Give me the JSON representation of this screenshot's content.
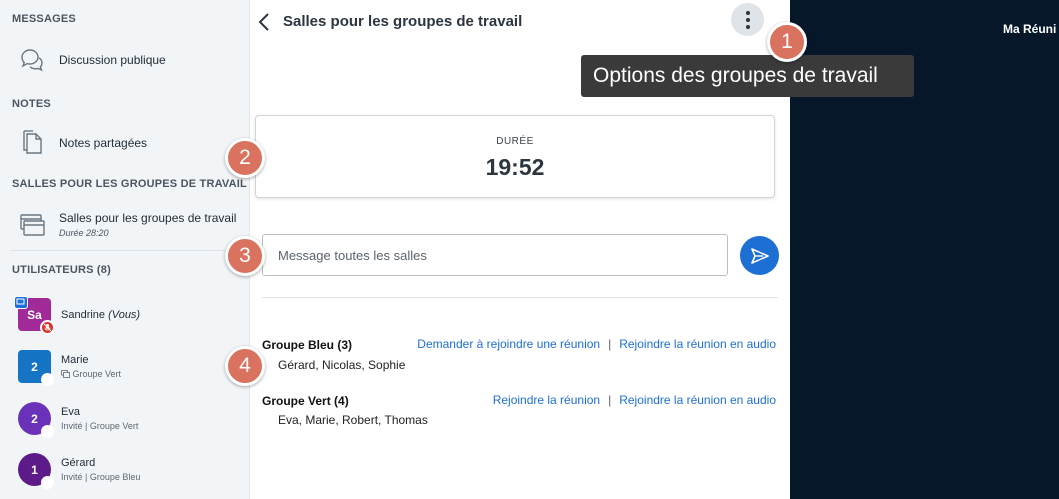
{
  "sidebar": {
    "messages_title": "MESSAGES",
    "public_chat": "Discussion publique",
    "notes_title": "NOTES",
    "shared_notes": "Notes partagées",
    "breakout_title": "SALLES POUR LES GROUPES DE TRAVAIL",
    "breakout_item": "Salles pour les groupes de travail",
    "breakout_duration": "Durée 28:20",
    "users_title": "UTILISATEURS (8)",
    "users": [
      {
        "initials": "Sa",
        "name": "Sandrine",
        "you": "(Vous)",
        "sub": "",
        "color": "#a02a98"
      },
      {
        "initials": "2",
        "name": "Marie",
        "you": "",
        "sub": "Groupe Vert",
        "color": "#1674c4"
      },
      {
        "initials": "2",
        "name": "Eva",
        "you": "",
        "sub": "Invité | Groupe Vert",
        "color": "#6a32b8"
      },
      {
        "initials": "1",
        "name": "Gérard",
        "you": "",
        "sub": "Invité | Groupe Bleu",
        "color": "#5c1b88"
      }
    ]
  },
  "panel": {
    "title": "Salles pour les groupes de travail",
    "duration_label": "DURÉE",
    "duration_value": "19:52",
    "message_placeholder": "Message toutes les salles",
    "groups": [
      {
        "name": "Groupe Bleu",
        "count": "(3)",
        "members": "Gérard, Nicolas, Sophie",
        "link1": "Demander à rejoindre une réunion",
        "separator": "|",
        "link2": "Rejoindre la réunion en audio"
      },
      {
        "name": "Groupe Vert",
        "count": "(4)",
        "members": "Eva, Marie, Robert, Thomas",
        "link1": "Rejoindre la réunion",
        "separator": "|",
        "link2": "Rejoindre la réunion en audio"
      }
    ]
  },
  "meeting_title": "Ma Réuni",
  "tooltip": "Options des groupes de travail",
  "callouts": [
    "1",
    "2",
    "3",
    "4"
  ],
  "colors": {
    "accent": "#1d6fd4",
    "callout": "#d9725e",
    "dark_bg": "#06172a",
    "sidebar_bg": "#f2f5f8"
  }
}
